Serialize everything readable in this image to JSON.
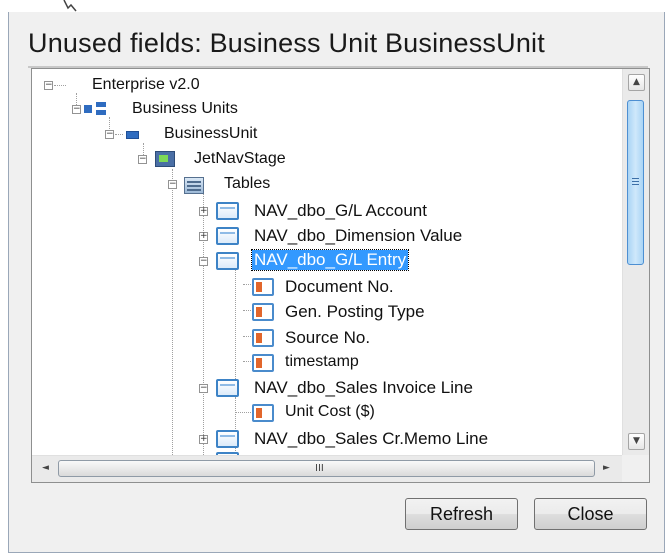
{
  "dialog": {
    "title": "Unused fields: Business Unit BusinessUnit"
  },
  "tree": {
    "nodes": [
      {
        "label": "Enterprise v2.0",
        "icon": "enterprise-icon",
        "expanded": true
      },
      {
        "label": "Business Units",
        "icon": "business-units-icon",
        "expanded": true
      },
      {
        "label": "BusinessUnit",
        "icon": "business-unit-icon",
        "expanded": true
      },
      {
        "label": "JetNavStage",
        "icon": "data-stage-icon",
        "expanded": true
      },
      {
        "label": "Tables",
        "icon": "tables-folder-icon",
        "expanded": true
      },
      {
        "label": "NAV_dbo_G/L Account",
        "icon": "table-icon",
        "expanded": false
      },
      {
        "label": "NAV_dbo_Dimension Value",
        "icon": "table-icon",
        "expanded": false
      },
      {
        "label": "NAV_dbo_G/L Entry",
        "icon": "table-icon",
        "expanded": true,
        "selected": true
      },
      {
        "label": "Document No.",
        "icon": "field-icon"
      },
      {
        "label": "Gen. Posting Type",
        "icon": "field-icon"
      },
      {
        "label": "Source No.",
        "icon": "field-icon"
      },
      {
        "label": "timestamp",
        "icon": "field-icon"
      },
      {
        "label": "NAV_dbo_Sales Invoice Line",
        "icon": "table-icon",
        "expanded": true
      },
      {
        "label": "Unit Cost ($)",
        "icon": "field-icon"
      },
      {
        "label": "NAV_dbo_Sales Cr.Memo Line",
        "icon": "table-icon",
        "expanded": false
      }
    ]
  },
  "scrollbars": {
    "vertical": {
      "up": "▲",
      "down": "▼",
      "position_fraction": 0.0
    },
    "horizontal": {
      "left": "◄",
      "right": "►",
      "grip": "III"
    }
  },
  "buttons": {
    "refresh": "Refresh",
    "close": "Close"
  },
  "colors": {
    "selection": "#3399ff",
    "dialog_background": "#f0f0f0"
  }
}
